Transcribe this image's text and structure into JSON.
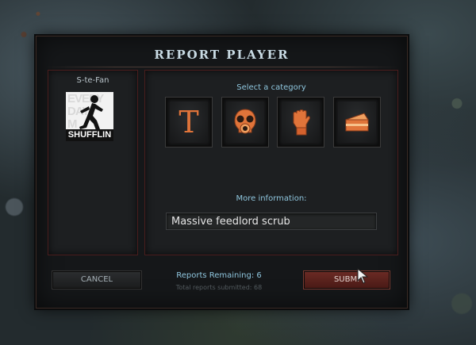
{
  "dialog": {
    "title": "REPORT PLAYER"
  },
  "player": {
    "name": "S-te-Fan",
    "avatar_text": "EVERY DAY SHUFFLIN"
  },
  "category": {
    "label": "Select a category",
    "options": [
      {
        "icon": "letter-t-icon",
        "glyph": "T"
      },
      {
        "icon": "gas-mask-icon"
      },
      {
        "icon": "raised-fist-icon"
      },
      {
        "icon": "cake-slice-icon"
      }
    ]
  },
  "more_info": {
    "label": "More information:",
    "value": "Massive feedlord scrub"
  },
  "footer": {
    "cancel_label": "CANCEL",
    "submit_label": "SUBMI",
    "reports_remaining": "Reports Remaining: 6",
    "total_submitted": "Total reports submitted: 68"
  },
  "colors": {
    "accent_blue": "#8fc6de",
    "icon_orange": "#e0743a",
    "panel_border": "#4a1d1d",
    "submit_bg": "#5a221d"
  }
}
